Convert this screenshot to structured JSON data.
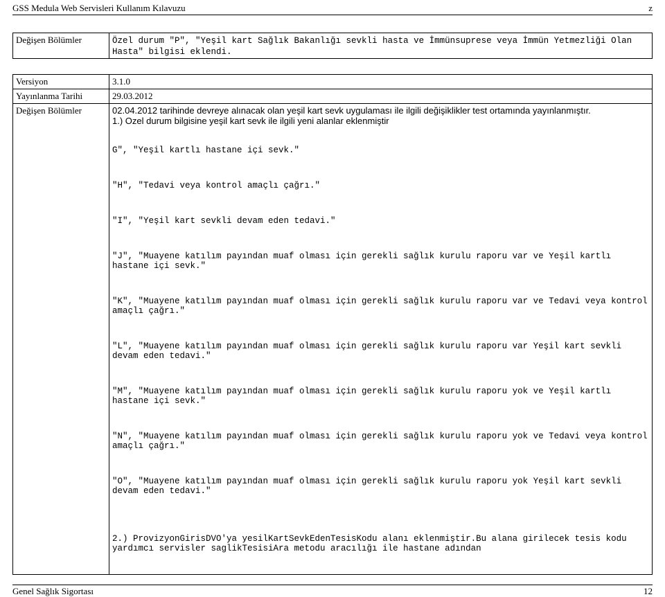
{
  "header": {
    "left": "GSS Medula Web Servisleri Kullanım Kılavuzu",
    "right": "z"
  },
  "table1": {
    "label": "Değişen Bölümler",
    "value": "Özel durum \"P\", \"Yeşil kart Sağlık Bakanlığı sevkli hasta ve İmmünsuprese veya İmmün Yetmezliği Olan Hasta\" bilgisi eklendi."
  },
  "table2": {
    "row1_label": "Versiyon",
    "row1_value": "3.1.0",
    "row2_label": "Yayınlanma Tarihi",
    "row2_value": "29.03.2012",
    "row3_label": "Değişen Bölümler",
    "row3": {
      "line1": "02.04.2012 tarihinde devreye alınacak olan yeşil kart sevk uygulaması ile ilgili değişiklikler test ortamında yayınlanmıştır.",
      "line2_sans": "1.) Ozel durum bilgisine yeşil kart sevk ile ilgili yeni alanlar eklenmiştir",
      "lineG": "G\", \"Yeşil kartlı hastane içi sevk.\"",
      "lineH": "\"H\", \"Tedavi veya kontrol amaçlı çağrı.\"",
      "lineI": "\"I\", \"Yeşil kart sevkli devam eden tedavi.\"",
      "lineJ": "\"J\", \"Muayene katılım payından muaf olması için gerekli sağlık kurulu raporu var ve Yeşil kartlı hastane içi sevk.\"",
      "lineK": "\"K\", \"Muayene katılım payından muaf olması için gerekli sağlık kurulu raporu var ve Tedavi veya kontrol amaçlı çağrı.\"",
      "lineL": "\"L\", \"Muayene katılım payından muaf olması için gerekli sağlık kurulu raporu var Yeşil kart sevkli devam eden tedavi.\"",
      "lineM": "\"M\", \"Muayene katılım payından muaf olması için gerekli sağlık kurulu raporu yok ve Yeşil kartlı hastane içi sevk.\"",
      "lineN": "\"N\", \"Muayene katılım payından muaf olması için gerekli sağlık kurulu raporu yok ve Tedavi veya kontrol amaçlı çağrı.\"",
      "lineO": "\"O\", \"Muayene katılım payından muaf olması için gerekli sağlık kurulu raporu yok Yeşil kart sevkli devam eden tedavi.\"",
      "line2": "2.) ProvizyonGirisDVO'ya yesilKartSevkEdenTesisKodu alanı eklenmiştir.Bu alana girilecek tesis kodu yardımcı servisler saglikTesisiAra metodu aracılığı ile hastane adından"
    }
  },
  "footer": {
    "left": "Genel Sağlık Sigortası",
    "right": "12"
  }
}
